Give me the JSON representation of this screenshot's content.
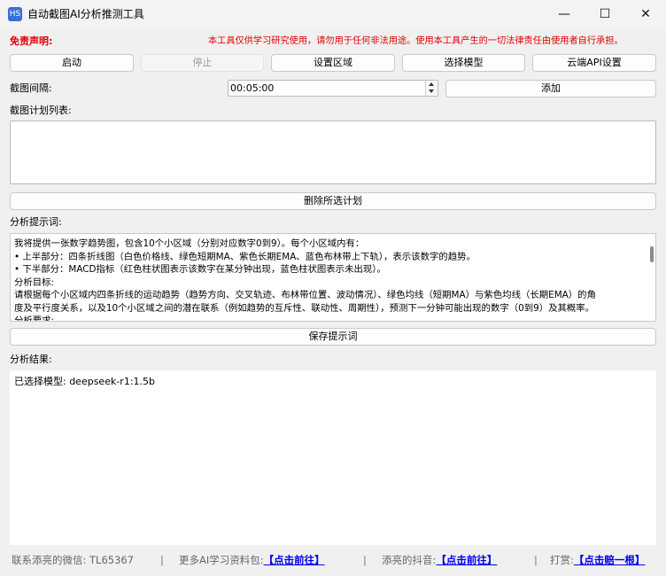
{
  "window": {
    "title": "自动截图AI分析推测工具",
    "icon_text": "HS",
    "minimize_glyph": "—",
    "maximize_glyph": "☐",
    "close_glyph": "✕"
  },
  "disclaimer": {
    "label": "免责声明:",
    "text": "本工具仅供学习研究使用，请勿用于任何非法用途。使用本工具产生的一切法律责任由使用者自行承担。",
    "color": "#e00000"
  },
  "toolbar": {
    "start_label": "启动",
    "stop_label": "停止",
    "set_region_label": "设置区域",
    "select_model_label": "选择模型",
    "cloud_api_label": "云端API设置"
  },
  "interval": {
    "label": "截图间隔:",
    "value": "00:05:00",
    "add_label": "添加"
  },
  "schedule": {
    "label": "截图计划列表:",
    "items": [],
    "delete_label": "删除所选计划"
  },
  "prompt": {
    "label": "分析提示词:",
    "lines": [
      "我将提供一张数字趋势图，包含10个小区域（分别对应数字0到9）。每个小区域内有：",
      "• 上半部分：四条折线图（白色价格线、绿色短期MA、紫色长期EMA、蓝色布林带上下轨），表示该数字的趋势。",
      "• 下半部分：MACD指标（红色柱状图表示该数字在某分钟出现，蓝色柱状图表示未出现）。",
      "分析目标:",
      "请根据每个小区域内四条折线的运动趋势（趋势方向、交叉轨迹、布林带位置、波动情况）、绿色均线（短期MA）与紫色均线（长期EMA）的角",
      "度及平行度关系，以及10个小区域之间的潜在联系（例如趋势的互斥性、联动性、周期性），预测下一分钟可能出现的数字（0到9）及其概率。",
      "分析要求:"
    ],
    "save_label": "保存提示词"
  },
  "results": {
    "label": "分析结果:",
    "text": "已选择模型: deepseek-r1:1.5b"
  },
  "footer": {
    "wechat": "联系添亮的微信: TL65367",
    "separator": "|",
    "materials_label": "更多AI学习资料包:",
    "materials_link": "【点击前往】",
    "douyin_label": "添亮的抖音:",
    "douyin_link": "【点击前往】",
    "tip_label": "打赏:",
    "tip_link": "【点击赔一根】"
  }
}
